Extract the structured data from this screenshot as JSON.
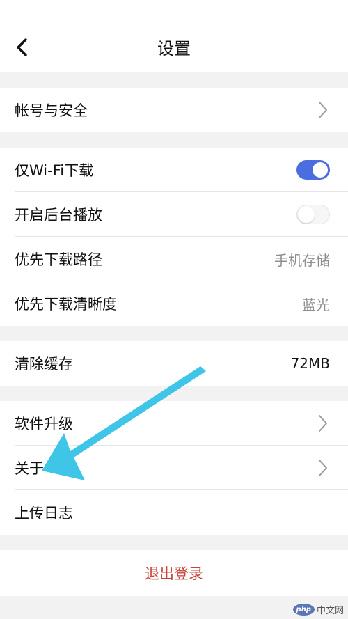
{
  "header": {
    "title": "设置",
    "back_icon": "chevron-left-icon"
  },
  "groups": {
    "account": {
      "label": "帐号与安全"
    },
    "download": {
      "wifi_only_label": "仅Wi-Fi下载",
      "wifi_only_enabled": true,
      "background_play_label": "开启后台播放",
      "background_play_enabled": false,
      "download_path_label": "优先下载路径",
      "download_path_value": "手机存储",
      "download_quality_label": "优先下载清晰度",
      "download_quality_value": "蓝光"
    },
    "cache": {
      "label": "清除缓存",
      "value": "72MB"
    },
    "about": {
      "upgrade_label": "软件升级",
      "about_label": "关于",
      "upload_log_label": "上传日志"
    }
  },
  "logout": {
    "label": "退出登录"
  },
  "colors": {
    "toggle_on": "#4a6ee0",
    "logout_text": "#c8413a",
    "annotation_arrow": "#3fc5e8"
  },
  "watermark": {
    "badge": "php",
    "site": "中文网"
  }
}
